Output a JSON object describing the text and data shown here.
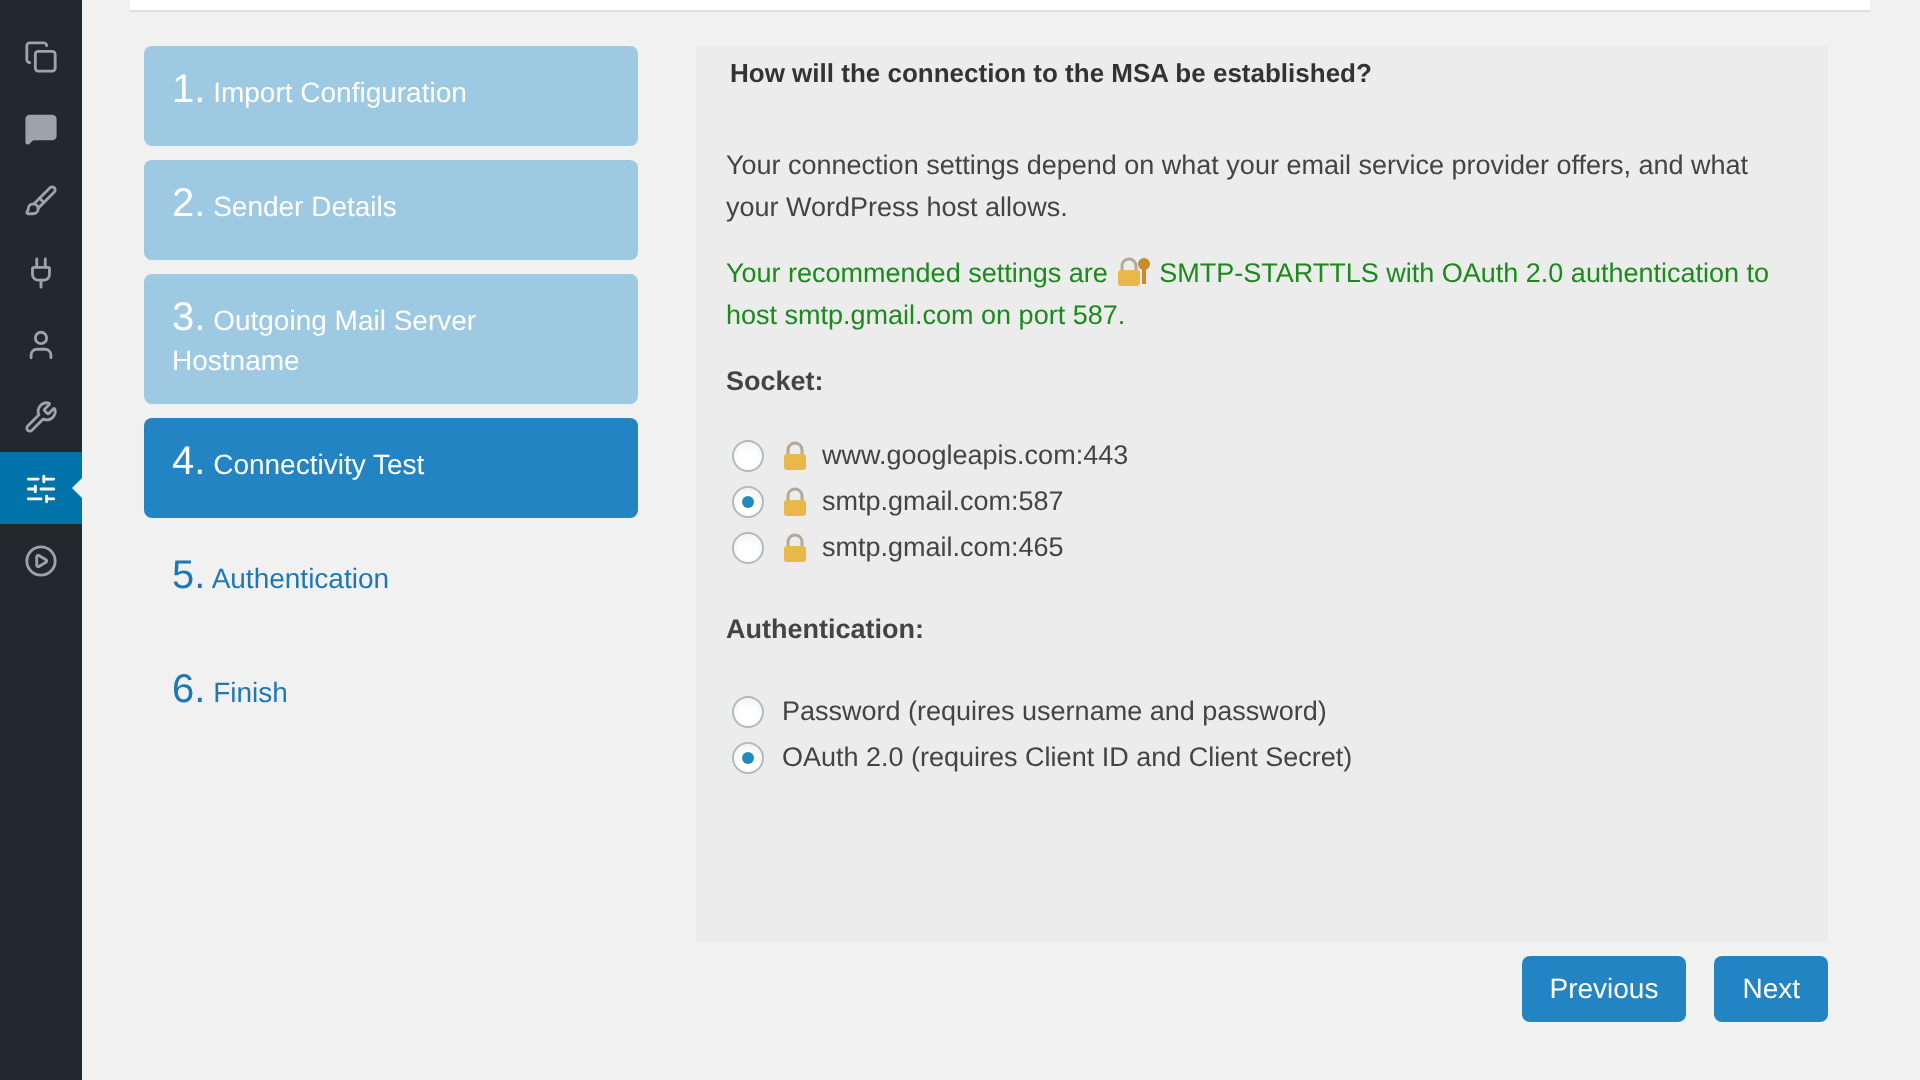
{
  "admin_menu": {
    "items": [
      {
        "selected": false
      },
      {
        "selected": false
      },
      {
        "selected": false
      },
      {
        "selected": false
      },
      {
        "selected": false
      },
      {
        "selected": false
      },
      {
        "selected": true
      },
      {
        "selected": false
      }
    ]
  },
  "steps": [
    {
      "number": "1.",
      "label": "Import Configuration",
      "completed": true,
      "selected": false
    },
    {
      "number": "2.",
      "label": "Sender Details",
      "completed": true,
      "selected": false
    },
    {
      "number": "3.",
      "label": "Outgoing Mail Server Hostname",
      "completed": true,
      "selected": false
    },
    {
      "number": "4.",
      "label": "Connectivity Test",
      "completed": false,
      "selected": true
    },
    {
      "number": "5.",
      "label": "Authentication",
      "completed": false,
      "selected": false
    },
    {
      "number": "6.",
      "label": "Finish",
      "completed": false,
      "selected": false
    }
  ],
  "panel": {
    "question": "How will the connection to the MSA be established?",
    "intro": "Your connection settings depend on what your email service provider offers, and what your WordPress host allows.",
    "recommendation": {
      "before": "Your recommended settings are",
      "after": "SMTP-STARTTLS with OAuth 2.0 authentication to host smtp.gmail.com on port 587."
    },
    "socket": {
      "label": "Socket:",
      "options": [
        {
          "label": "www.googleapis.com:443",
          "secure": true,
          "selected": false
        },
        {
          "label": "smtp.gmail.com:587",
          "secure": true,
          "selected": true
        },
        {
          "label": "smtp.gmail.com:465",
          "secure": true,
          "selected": false
        }
      ]
    },
    "authentication": {
      "label": "Authentication:",
      "options": [
        {
          "label": "Password (requires username and password)",
          "selected": false
        },
        {
          "label": "OAuth 2.0 (requires Client ID and Client Secret)",
          "selected": true
        }
      ]
    }
  },
  "buttons": [
    "Previous",
    "Next"
  ]
}
